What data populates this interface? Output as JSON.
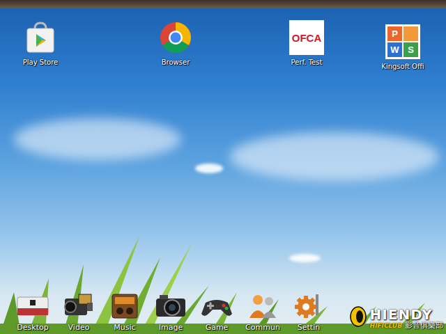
{
  "desktop_icons": [
    {
      "label": "Play Store"
    },
    {
      "label": "Browser"
    },
    {
      "label": "Perf. Test",
      "logo": "OFCA"
    },
    {
      "label": "Kingsoft Offi",
      "logo": [
        {
          "text": "P",
          "color": "#e8672a"
        },
        {
          "text": "W",
          "color": "#2f6fd0"
        },
        {
          "text": "S",
          "color": "#3aa04a"
        }
      ]
    }
  ],
  "dock": [
    {
      "label": "Desktop"
    },
    {
      "label": "Video"
    },
    {
      "label": "Music"
    },
    {
      "label": "Image"
    },
    {
      "label": "Game"
    },
    {
      "label": "Commun"
    },
    {
      "label": "Settin"
    }
  ],
  "watermark": {
    "brand": "HIENDY",
    "sub": "HIFICLUB",
    "chinese": "影音俱樂部"
  }
}
